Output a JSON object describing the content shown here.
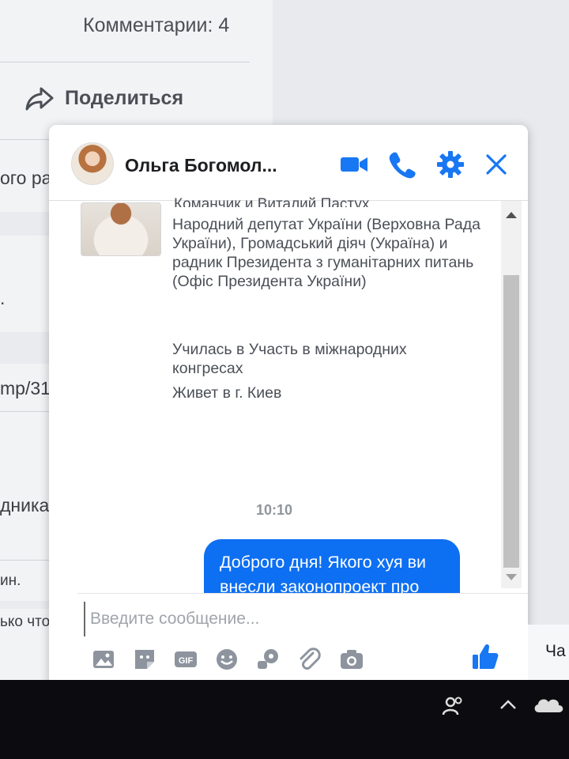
{
  "feed": {
    "comments_count": "Комментарии: 4",
    "share_label": "Поделиться",
    "snippet_1": "ого ра",
    "snippet_2": ".",
    "snippet_3": "mp/31",
    "snippet_4": "дника",
    "snippet_5": "ин.",
    "snippet_6": "ько что"
  },
  "chat": {
    "contact_name": "Ольга Богомол...",
    "header_icons": [
      "video-camera-icon",
      "phone-icon",
      "gear-icon",
      "close-icon"
    ],
    "partial_line": "Команчик и Виталий Пастух",
    "bio_lines": [
      "Народний депутат України (Верховна Рада України), Громадський діяч (Україна) и радник Президента з гуманітарних питань (Офіс Президента України)",
      "Училась в Участь в міжнародних конгресах",
      "Живет в г. Киев"
    ],
    "timestamp": "10:10",
    "message": "Доброго дня! Якого хуя ви внесли законопроект про дематюкацію?",
    "composer_placeholder": "Введите сообщение...",
    "composer_tools": [
      "image-icon",
      "sticker-icon",
      "gif-icon",
      "emoji-icon",
      "game-icon",
      "attachment-icon",
      "camera-icon",
      "like-icon"
    ]
  },
  "right_panel": {
    "cha_label": "Ча"
  },
  "colors": {
    "accent": "#1877f2",
    "bubble": "#0d6ff2"
  }
}
